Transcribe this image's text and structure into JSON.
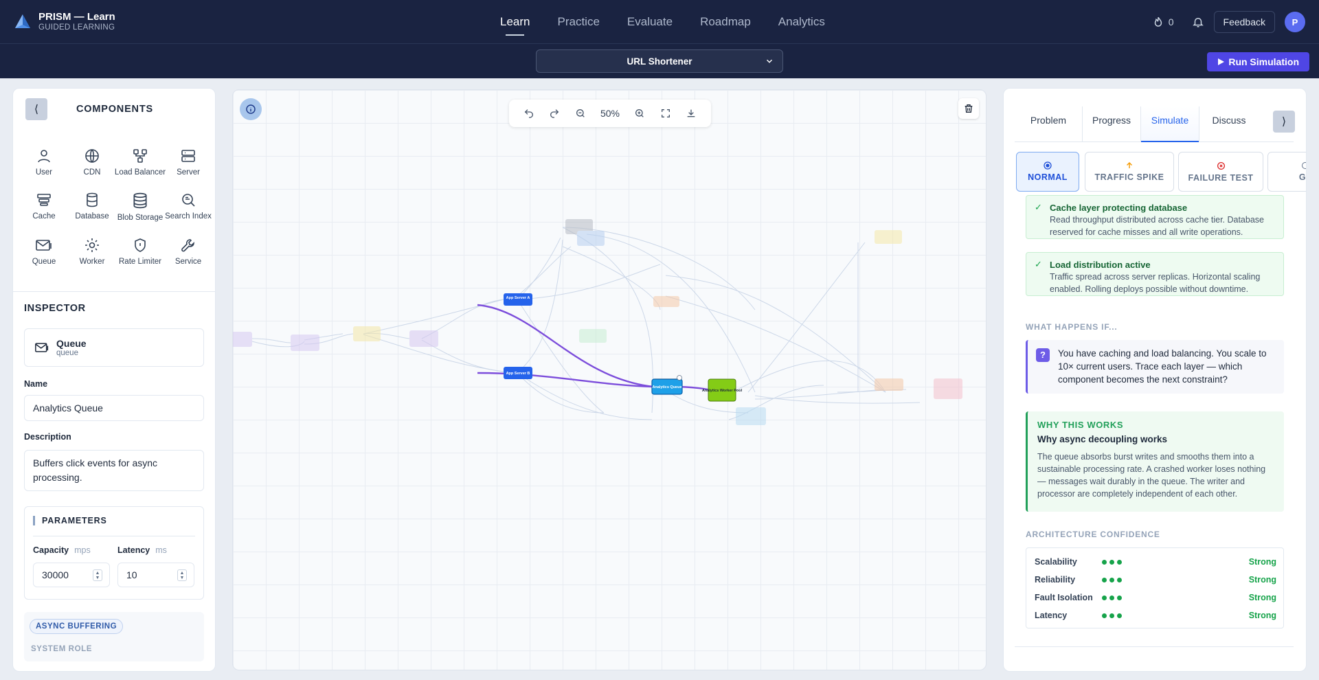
{
  "brand": {
    "title": "PRISM — Learn",
    "subtitle": "GUIDED LEARNING"
  },
  "nav": {
    "tabs": [
      "Learn",
      "Practice",
      "Evaluate",
      "Roadmap",
      "Analytics"
    ],
    "active": "Learn"
  },
  "header": {
    "streak_count": "0",
    "feedback_label": "Feedback",
    "avatar_initial": "P"
  },
  "problem_select": {
    "value": "URL Shortener"
  },
  "run_label": "Run Simulation",
  "components": {
    "title": "COMPONENTS",
    "items": [
      {
        "label": "User",
        "icon": "user-icon"
      },
      {
        "label": "CDN",
        "icon": "globe-icon"
      },
      {
        "label": "Load Balancer",
        "icon": "network-icon"
      },
      {
        "label": "Server",
        "icon": "server-icon"
      },
      {
        "label": "Cache",
        "icon": "cache-icon"
      },
      {
        "label": "Database",
        "icon": "database-icon"
      },
      {
        "label": "Blob Storage",
        "icon": "cylinder-icon"
      },
      {
        "label": "Search Index",
        "icon": "search-icon"
      },
      {
        "label": "Queue",
        "icon": "mail-icon"
      },
      {
        "label": "Worker",
        "icon": "gear-icon"
      },
      {
        "label": "Rate Limiter",
        "icon": "shield-icon"
      },
      {
        "label": "Service",
        "icon": "wrench-icon"
      }
    ]
  },
  "inspector": {
    "title": "INSPECTOR",
    "selected_name": "Queue",
    "selected_type": "queue",
    "name_label": "Name",
    "name_value": "Analytics Queue",
    "description_label": "Description",
    "description_value": "Buffers click events for async processing.",
    "params_title": "PARAMETERS",
    "capacity_label": "Capacity",
    "capacity_unit": "mps",
    "capacity_value": "30000",
    "latency_label": "Latency",
    "latency_unit": "ms",
    "latency_value": "10",
    "role_chip": "ASYNC BUFFERING",
    "role_label": "SYSTEM ROLE"
  },
  "canvas": {
    "zoom": "50%",
    "nodes": [
      {
        "label": "App Server A",
        "highlight": true
      },
      {
        "label": "App Server B",
        "highlight": true
      },
      {
        "label": "Analytics Queue",
        "highlight": true
      },
      {
        "label": "Analytics Worker Pool",
        "highlight": true
      }
    ]
  },
  "right": {
    "tabs": [
      "Problem",
      "Progress",
      "Simulate",
      "Discuss"
    ],
    "active_tab": "Simulate",
    "modes": [
      {
        "label": "NORMAL",
        "icon": "radio-icon"
      },
      {
        "label": "TRAFFIC SPIKE",
        "icon": "arrow-up-icon"
      },
      {
        "label": "FAILURE TEST",
        "icon": "x-circle-icon"
      },
      {
        "label": "GL",
        "icon": "globe-icon"
      }
    ],
    "active_mode": "NORMAL",
    "insights": [
      {
        "title": "Cache layer protecting database",
        "text": "Read throughput distributed across cache tier. Database reserved for cache misses and all write operations."
      },
      {
        "title": "Load distribution active",
        "text": "Traffic spread across server replicas. Horizontal scaling enabled. Rolling deploys possible without downtime."
      }
    ],
    "what_happens_title": "WHAT HAPPENS IF...",
    "what_happens_text": "You have caching and load balancing. You scale to 10× current users. Trace each layer — which component becomes the next constraint?",
    "why_tag": "WHY THIS WORKS",
    "why_title": "Why async decoupling works",
    "why_text": "The queue absorbs burst writes and smooths them into a sustainable processing rate. A crashed worker loses nothing — messages wait durably in the queue. The writer and processor are completely independent of each other.",
    "confidence_title": "ARCHITECTURE CONFIDENCE",
    "confidence": [
      {
        "label": "Scalability",
        "rating": "Strong",
        "dots": 3
      },
      {
        "label": "Reliability",
        "rating": "Strong",
        "dots": 3
      },
      {
        "label": "Fault Isolation",
        "rating": "Strong",
        "dots": 3
      },
      {
        "label": "Latency",
        "rating": "Strong",
        "dots": 3
      }
    ]
  },
  "colors": {
    "nav_bg": "#1a2341",
    "accent": "#4f46e5",
    "highlight_edge": "#7c4ddb",
    "success": "#16a34a"
  }
}
